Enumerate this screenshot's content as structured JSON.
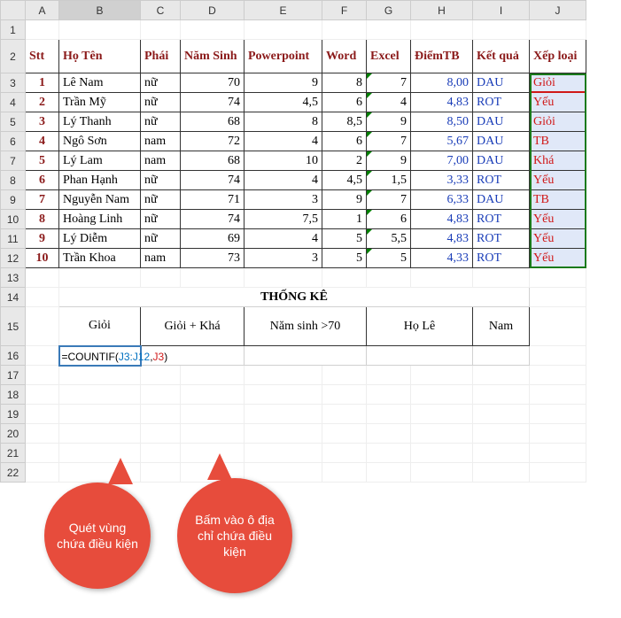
{
  "columns": [
    "A",
    "B",
    "C",
    "D",
    "E",
    "F",
    "G",
    "H",
    "I",
    "J"
  ],
  "selected_col": "B",
  "headers": {
    "stt": "Stt",
    "hoten": "Họ Tên",
    "phai": "Phái",
    "namsinh": "Năm Sinh",
    "pp": "Powerpoint",
    "word": "Word",
    "excel": "Excel",
    "diemtb": "ĐiểmTB",
    "ketqua": "Kết quả",
    "xeploai": "Xếp loại"
  },
  "rows": [
    {
      "stt": "1",
      "hoten": "Lê Nam",
      "phai": "nữ",
      "namsinh": "70",
      "pp": "9",
      "word": "8",
      "excel": "7",
      "diemtb": "8,00",
      "ketqua": "DAU",
      "xeploai": "Giỏi"
    },
    {
      "stt": "2",
      "hoten": "Trần Mỹ",
      "phai": "nữ",
      "namsinh": "74",
      "pp": "4,5",
      "word": "6",
      "excel": "4",
      "diemtb": "4,83",
      "ketqua": "ROT",
      "xeploai": "Yếu"
    },
    {
      "stt": "3",
      "hoten": "Lý Thanh",
      "phai": "nữ",
      "namsinh": "68",
      "pp": "8",
      "word": "8,5",
      "excel": "9",
      "diemtb": "8,50",
      "ketqua": "DAU",
      "xeploai": "Giỏi"
    },
    {
      "stt": "4",
      "hoten": "Ngô Sơn",
      "phai": "nam",
      "namsinh": "72",
      "pp": "4",
      "word": "6",
      "excel": "7",
      "diemtb": "5,67",
      "ketqua": "DAU",
      "xeploai": "TB"
    },
    {
      "stt": "5",
      "hoten": "Lý Lam",
      "phai": "nam",
      "namsinh": "68",
      "pp": "10",
      "word": "2",
      "excel": "9",
      "diemtb": "7,00",
      "ketqua": "DAU",
      "xeploai": "Khá"
    },
    {
      "stt": "6",
      "hoten": "Phan Hạnh",
      "phai": "nữ",
      "namsinh": "74",
      "pp": "4",
      "word": "4,5",
      "excel": "1,5",
      "diemtb": "3,33",
      "ketqua": "ROT",
      "xeploai": "Yếu"
    },
    {
      "stt": "7",
      "hoten": "Nguyễn Nam",
      "phai": "nữ",
      "namsinh": "71",
      "pp": "3",
      "word": "9",
      "excel": "7",
      "diemtb": "6,33",
      "ketqua": "DAU",
      "xeploai": "TB"
    },
    {
      "stt": "8",
      "hoten": "Hoàng Linh",
      "phai": "nữ",
      "namsinh": "74",
      "pp": "7,5",
      "word": "1",
      "excel": "6",
      "diemtb": "4,83",
      "ketqua": "ROT",
      "xeploai": "Yếu"
    },
    {
      "stt": "9",
      "hoten": "Lý Diễm",
      "phai": "nữ",
      "namsinh": "69",
      "pp": "4",
      "word": "5",
      "excel": "5,5",
      "diemtb": "4,83",
      "ketqua": "ROT",
      "xeploai": "Yếu"
    },
    {
      "stt": "10",
      "hoten": "Trần Khoa",
      "phai": "nam",
      "namsinh": "73",
      "pp": "3",
      "word": "5",
      "excel": "5",
      "diemtb": "4,33",
      "ketqua": "ROT",
      "xeploai": "Yếu"
    }
  ],
  "thongke": {
    "title": "THỐNG KÊ",
    "cols": [
      "Giỏi",
      "Giỏi + Khá",
      "Năm sinh >70",
      "Họ Lê",
      "Nam"
    ]
  },
  "formula": {
    "eq": "=",
    "fn": "COUNTIF(",
    "range": "J3:J12",
    "comma": ",",
    "ref": "J3",
    "close": ")"
  },
  "callouts": {
    "c1": "Quét vùng chứa điều kiện",
    "c2": "Bấm vào ô địa chỉ chứa điều kiện"
  },
  "row_numbers": [
    "1",
    "2",
    "3",
    "4",
    "5",
    "6",
    "7",
    "8",
    "9",
    "10",
    "11",
    "12",
    "13",
    "14",
    "15",
    "16",
    "17",
    "18",
    "19",
    "20",
    "21",
    "22"
  ],
  "col_widths": {
    "A": 38,
    "B": 92,
    "C": 45,
    "D": 72,
    "E": 88,
    "F": 50,
    "G": 50,
    "H": 70,
    "I": 64,
    "J": 64
  }
}
